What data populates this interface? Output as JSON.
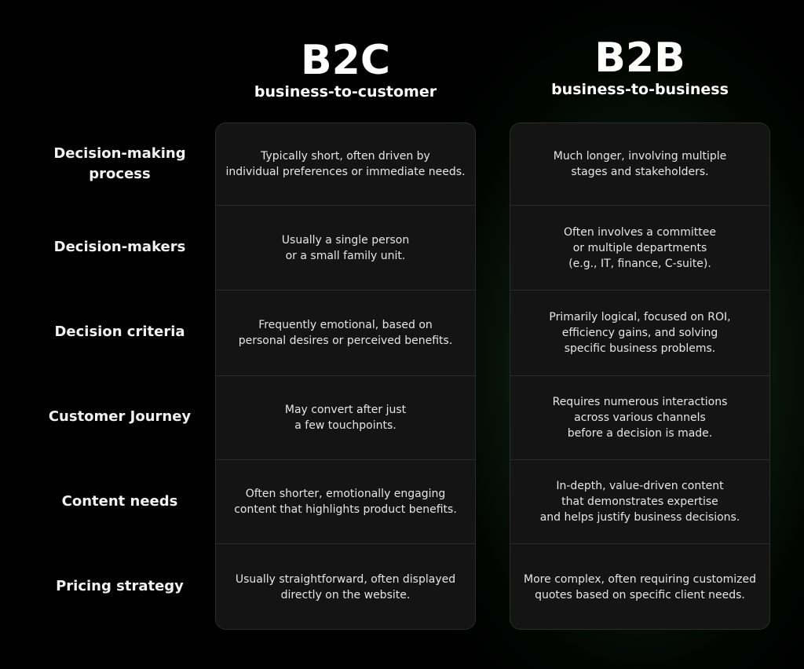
{
  "columns": [
    {
      "key": "b2c",
      "title": "B2C",
      "subtitle": "business-to-customer",
      "cells": [
        "Typically short, often driven by\nindividual preferences or immediate needs.",
        "Usually a single person\nor a small family unit.",
        "Frequently emotional, based on\npersonal desires or perceived benefits.",
        "May convert after just\na few touchpoints.",
        "Often shorter, emotionally engaging\ncontent that highlights product benefits.",
        "Usually straightforward, often displayed\ndirectly on the website."
      ]
    },
    {
      "key": "b2b",
      "title": "B2B",
      "subtitle": "business-to-business",
      "cells": [
        "Much longer, involving multiple\nstages and stakeholders.",
        "Often involves a committee\nor multiple departments\n(e.g., IT, finance, C-suite).",
        "Primarily logical, focused on ROI,\nefficiency gains, and solving\nspecific business problems.",
        "Requires numerous interactions\nacross various channels\nbefore a decision is made.",
        "In-depth, value-driven content\nthat demonstrates expertise\nand helps justify business decisions.",
        "More complex, often requiring customized\nquotes based on specific client needs."
      ]
    }
  ],
  "row_labels": [
    "Decision-making\nprocess",
    "Decision-makers",
    "Decision criteria",
    "Customer Journey",
    "Content needs",
    "Pricing strategy"
  ],
  "colors": {
    "background": "#000000",
    "card": "#141414",
    "card_border": "#2c2c2c",
    "accent_glow": "#1a4a1c",
    "text": "#ffffff"
  }
}
